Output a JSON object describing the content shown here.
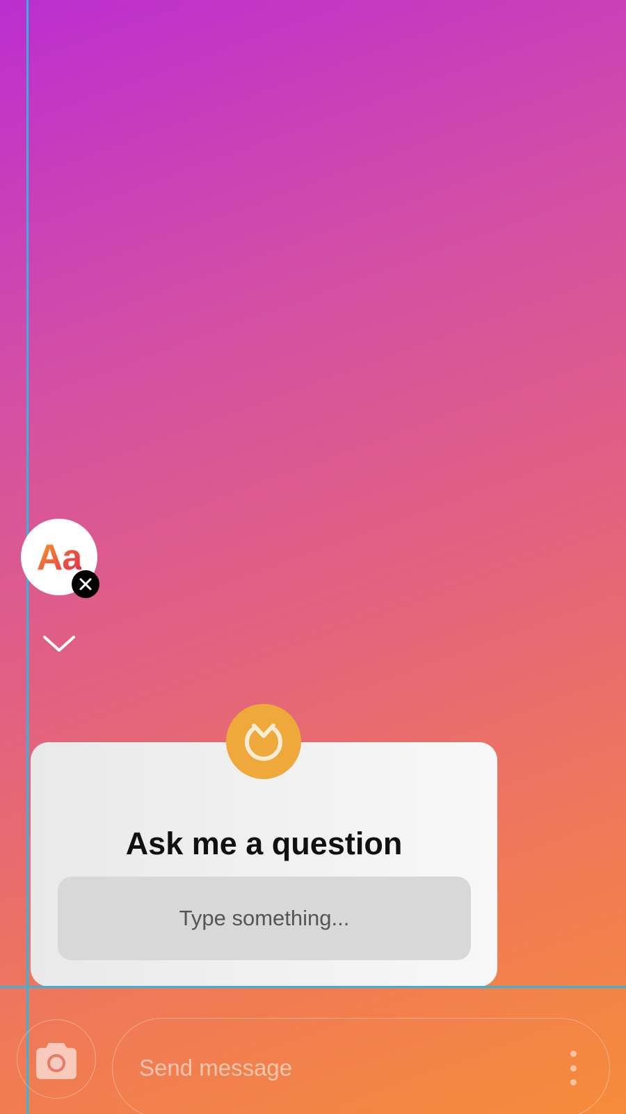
{
  "canvas": {
    "background_start": "#bb2ed0",
    "background_end": "#f68c3a",
    "guide_color": "#2fb6e0"
  },
  "text_sticker": {
    "label": "Aa",
    "icon": "text-style-icon",
    "remove_icon": "close-icon"
  },
  "collapse": {
    "icon": "chevron-down-icon"
  },
  "question_sticker": {
    "logo_icon": "question-sticker-logo-icon",
    "logo_color": "#efa83a",
    "title": "Ask me a question",
    "placeholder": "Type something..."
  },
  "reply_bar": {
    "camera_icon": "camera-icon",
    "placeholder": "Send message",
    "more_icon": "more-vertical-icon"
  }
}
